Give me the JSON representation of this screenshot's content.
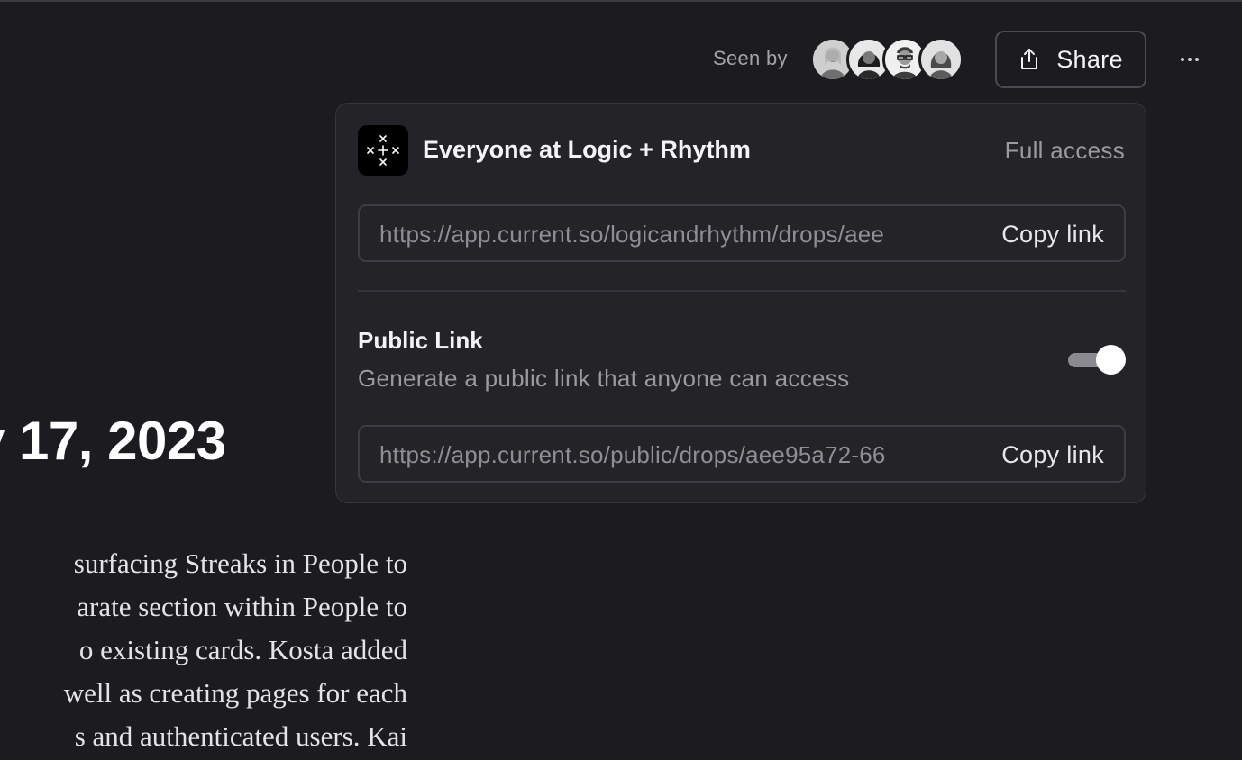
{
  "header": {
    "seen_by_label": "Seen by",
    "avatars": [
      {
        "name": "avatar-1"
      },
      {
        "name": "avatar-2"
      },
      {
        "name": "avatar-3"
      },
      {
        "name": "avatar-4"
      }
    ],
    "share_label": "Share",
    "share_icon": "share-icon",
    "more_icon": "more-icon"
  },
  "share_popover": {
    "org": {
      "name": "Everyone at Logic + Rhythm",
      "access": "Full access",
      "logo": "logic-rhythm-logo"
    },
    "org_link": {
      "url": "https://app.current.so/logicandrhythm/drops/aee",
      "copy_label": "Copy link"
    },
    "public_link": {
      "title": "Public Link",
      "description": "Generate a public link that anyone can access",
      "enabled": true,
      "url": "https://app.current.so/public/drops/aee95a72-66",
      "copy_label": "Copy link"
    }
  },
  "document": {
    "date_heading": "y 17, 2023",
    "body_lines": [
      "surfacing Streaks in People to",
      "arate section within People to",
      "o existing cards. Kosta added",
      "well as creating pages for each",
      "s and authenticated users. Kai"
    ]
  },
  "colors": {
    "background": "#1c1c20",
    "popover": "#242328",
    "border": "#36353b",
    "muted_text": "#9a9a9f",
    "toggle_track": "#8a8a90"
  }
}
